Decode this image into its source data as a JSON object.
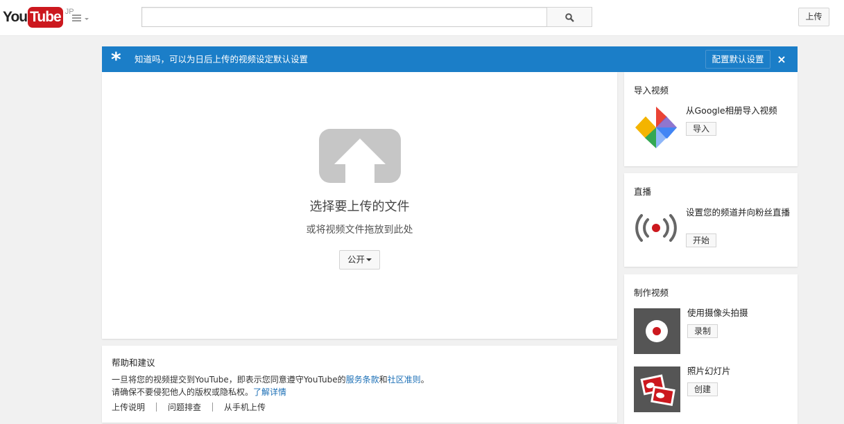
{
  "header": {
    "logo_you": "You",
    "logo_tube": "Tube",
    "logo_region": "JP",
    "search_placeholder": "",
    "upload_label": "上传"
  },
  "notice": {
    "star": "*",
    "text": "知道吗，可以为日后上传的视频设定默认设置",
    "config_label": "配置默认设置",
    "close": "×",
    "color": "#1b7ec8"
  },
  "upload": {
    "title": "选择要上传的文件",
    "subtitle": "或将视频文件拖放到此处",
    "privacy_label": "公开"
  },
  "help": {
    "title": "帮助和建议",
    "line1_before": "一旦将您的视频提交到YouTube，即表示您同意遵守YouTube的",
    "terms_link": "服务条款",
    "and": "和",
    "guidelines_link": "社区准则",
    "line1_end": "。",
    "line2": "请确保不要侵犯他人的版权或隐私权。",
    "learn_more": "了解详情",
    "links": [
      "上传说明",
      "问题排查",
      "从手机上传"
    ]
  },
  "sidebar": {
    "import": {
      "title": "导入视频",
      "desc": "从Google相册导入视频",
      "button": "导入"
    },
    "live": {
      "title": "直播",
      "desc": "设置您的频道并向粉丝直播",
      "button": "开始"
    },
    "create": {
      "title": "制作视频",
      "webcam_desc": "使用摄像头拍摄",
      "webcam_button": "录制",
      "slideshow_desc": "照片幻灯片",
      "slideshow_button": "创建"
    }
  },
  "colors": {
    "brand_red": "#cc181e",
    "link_blue": "#1b6fb6"
  }
}
